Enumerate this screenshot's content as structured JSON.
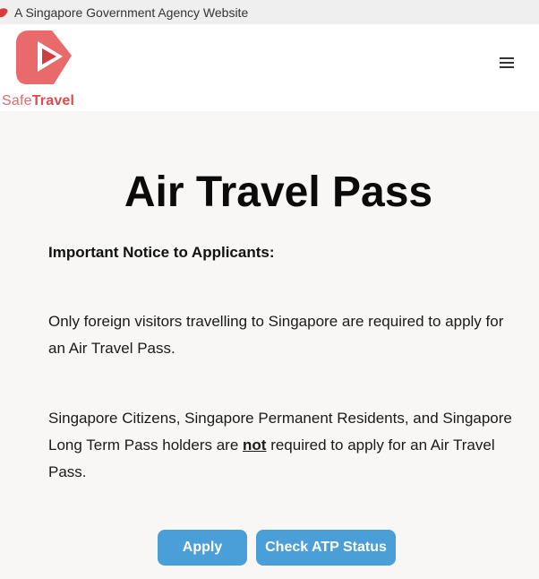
{
  "gov_banner": {
    "text": "A Singapore Government Agency Website",
    "icon": "singapore-lion-icon"
  },
  "header": {
    "logo_part1": "Safe",
    "logo_part2": "Travel",
    "logo_icon": "safetravel-play-logo",
    "menu_icon": "hamburger-menu-icon"
  },
  "main": {
    "title": "Air Travel Pass",
    "notice_heading": "Important Notice to Applicants:",
    "para1": "Only foreign visitors travelling to Singapore are required to apply for an Air Travel Pass.",
    "para2_before": "Singapore Citizens, Singapore Permanent Residents, and Singapore Long Term Pass holders are ",
    "para2_emph": "not",
    "para2_after": " required to apply for an Air Travel Pass."
  },
  "actions": {
    "apply_label": "Apply",
    "status_label": "Check ATP Status"
  },
  "colors": {
    "brand_red": "#e04a4a",
    "button_blue": "#4a9fd8",
    "page_bg": "#f8f7f5"
  }
}
